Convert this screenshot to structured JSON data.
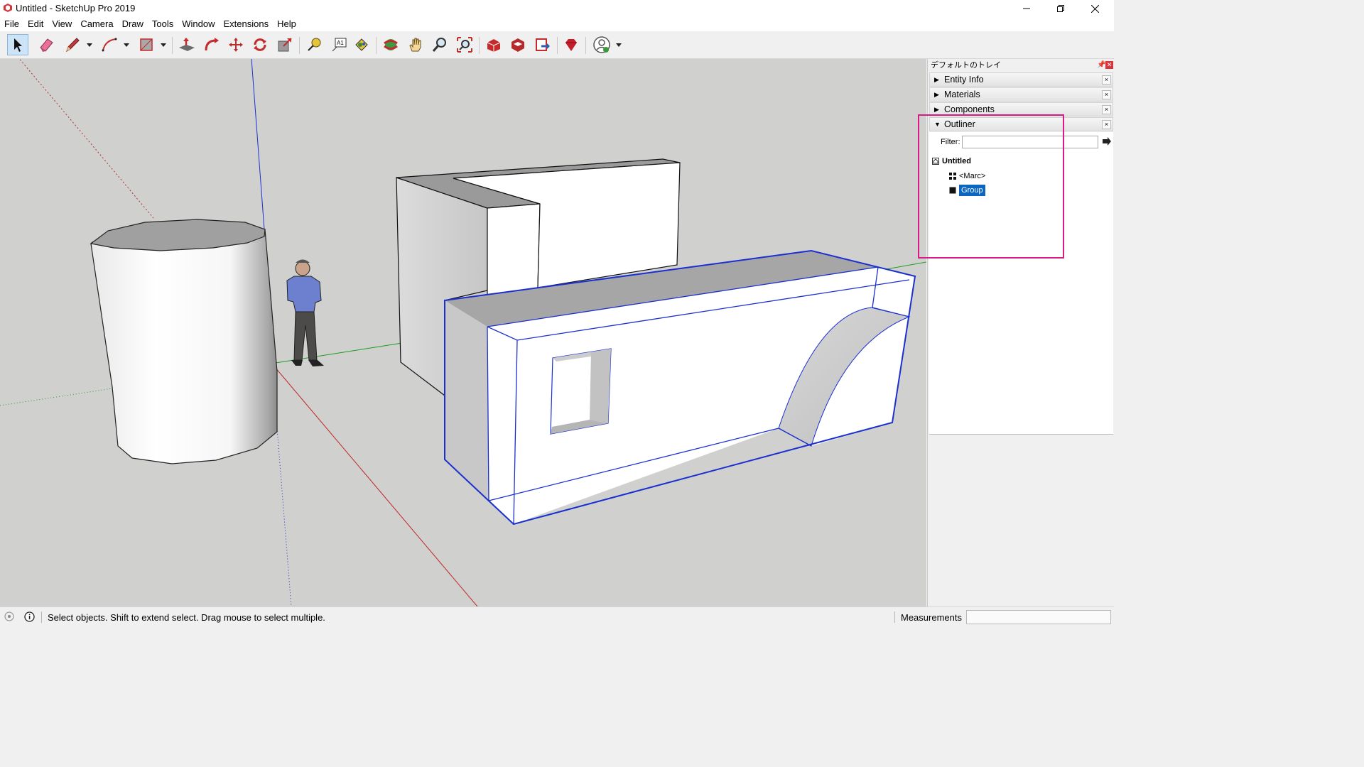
{
  "window": {
    "title": "Untitled - SketchUp Pro 2019"
  },
  "menu": [
    "File",
    "Edit",
    "View",
    "Camera",
    "Draw",
    "Tools",
    "Window",
    "Extensions",
    "Help"
  ],
  "toolbar": {
    "tools": [
      "select-tool",
      "eraser-tool",
      "line-tool",
      "arc-tool",
      "rectangle-tool",
      "push-pull-tool",
      "follow-me-tool",
      "move-tool",
      "rotate-tool",
      "scale-tool",
      "tape-measure-tool",
      "text-tool",
      "paint-bucket-tool",
      "orbit-tool",
      "pan-tool",
      "zoom-tool",
      "zoom-extents-tool",
      "warehouse-tool",
      "extension-warehouse-tool",
      "layout-tool",
      "extension-manager-tool",
      "account-tool"
    ]
  },
  "tray": {
    "title": "デフォルトのトレイ",
    "panels": [
      "Entity Info",
      "Materials",
      "Components",
      "Outliner"
    ],
    "outliner": {
      "filter_label": "Filter:",
      "filter_value": "",
      "root": "Untitled",
      "items": [
        "<Marc>",
        "Group"
      ]
    }
  },
  "status": {
    "message": "Select objects. Shift to extend select. Drag mouse to select multiple.",
    "measurements_label": "Measurements",
    "measurements_value": ""
  },
  "colors": {
    "selection": "#1020d8",
    "highlight_box": "#d81b84",
    "selected_row": "#0a66c2"
  }
}
